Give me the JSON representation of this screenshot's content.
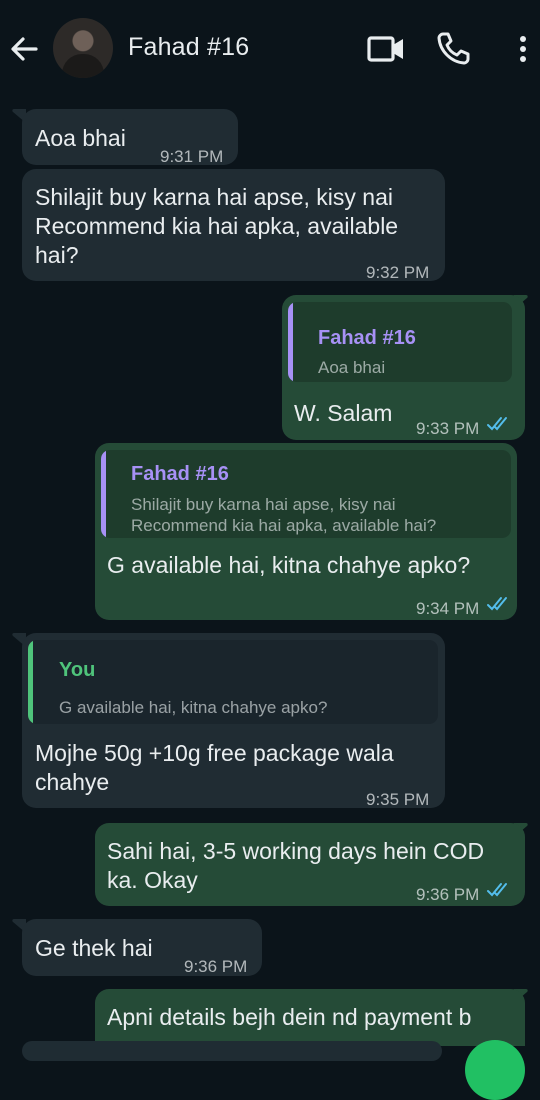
{
  "header": {
    "contact_name": "Fahad #16"
  },
  "messages": [
    {
      "dir": "in",
      "text": "Aoa bhai",
      "time": "9:31 PM"
    },
    {
      "dir": "in",
      "text": "Shilajit buy karna hai apse, kisy nai\nRecommend kia hai apka, available\nhai?",
      "time": "9:32 PM"
    },
    {
      "dir": "out",
      "quote_name": "Fahad #16",
      "quote_text": "Aoa bhai",
      "text": "W. Salam",
      "time": "9:33 PM",
      "read": true
    },
    {
      "dir": "out",
      "quote_name": "Fahad #16",
      "quote_text": "Shilajit buy karna hai apse, kisy nai\nRecommend kia hai apka, available hai?",
      "text": "G available hai, kitna chahye apko?",
      "time": "9:34 PM",
      "read": true
    },
    {
      "dir": "in",
      "quote_name": "You",
      "quote_text": "G available hai, kitna chahye apko?",
      "text": "Mojhe 50g +10g free package wala\nchahye",
      "time": "9:35 PM"
    },
    {
      "dir": "out",
      "text": "Sahi hai, 3-5 working days hein COD\nka. Okay",
      "time": "9:36 PM",
      "read": true
    },
    {
      "dir": "in",
      "text": "Ge thek hai",
      "time": "9:36 PM"
    },
    {
      "dir": "out",
      "text": "Apni details bejh dein nd payment b",
      "partial": true
    }
  ],
  "colors": {
    "background": "#0b141a",
    "incoming": "#202c33",
    "outgoing": "#254b37",
    "quote_purple": "#a791f5",
    "quote_green": "#4fc47b",
    "read_ticks": "#53bdeb"
  }
}
